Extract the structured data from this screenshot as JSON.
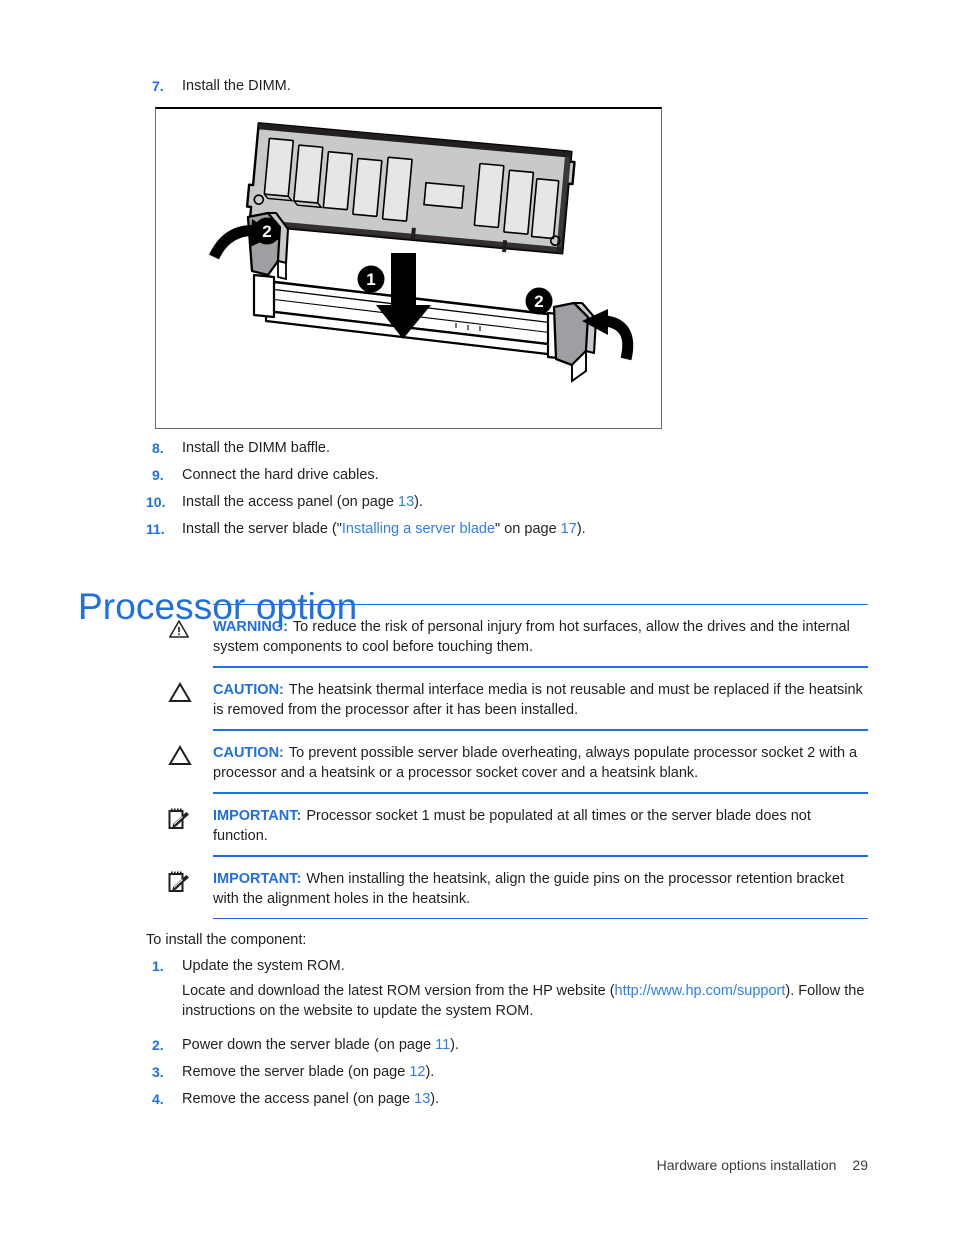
{
  "document": {
    "steps_top": [
      {
        "number": "7.",
        "text": "Install the DIMM."
      }
    ],
    "figure": {
      "caption_alt": "DIMM installation into socket",
      "callouts": [
        {
          "label": "1",
          "meaning": "press DIMM straight down into socket"
        },
        {
          "label": "2",
          "meaning": "left latch closes"
        },
        {
          "label": "2",
          "meaning": "right latch closes"
        }
      ]
    },
    "steps_after_figure": [
      {
        "number": "8.",
        "text": "Install the DIMM baffle."
      },
      {
        "number": "9.",
        "text": "Connect the hard drive cables."
      },
      {
        "number": "10.",
        "text": "Install the access panel (on page ",
        "page": "13",
        "tail": ")."
      },
      {
        "number": "11.",
        "text": "Install the server blade (\"",
        "link": "Installing a server blade",
        "mid": "\" on page ",
        "page": "17",
        "tail": ")."
      }
    ],
    "heading": "Processor option",
    "notices": [
      {
        "icon": "warning-triangle-exclamation-icon",
        "label": "WARNING:",
        "text": "To reduce the risk of personal injury from hot surfaces, allow the drives and the internal system components to cool before touching them."
      },
      {
        "icon": "caution-triangle-icon",
        "label": "CAUTION:",
        "text": "The heatsink thermal interface media is not reusable and must be replaced if the heatsink is removed from the processor after it has been installed."
      },
      {
        "icon": "caution-triangle-icon",
        "label": "CAUTION:",
        "text": "To prevent possible server blade overheating, always populate processor socket 2 with a processor and a heatsink or a processor socket cover and a heatsink blank."
      },
      {
        "icon": "important-notepad-pencil-icon",
        "label": "IMPORTANT:",
        "text": "Processor socket 1 must be populated at all times or the server blade does not function."
      },
      {
        "icon": "important-notepad-pencil-icon",
        "label": "IMPORTANT:",
        "text": "When installing the heatsink, align the guide pins on the processor retention bracket with the alignment holes in the heatsink."
      }
    ],
    "lead_in": "To install the component:",
    "steps_bottom": [
      {
        "number": "1.",
        "text": "Update the system ROM.",
        "sub_pre": "Locate and download the latest ROM version from the HP website (",
        "sub_link": "http://www.hp.com/support",
        "sub_post": "). Follow the instructions on the website to update the system ROM."
      },
      {
        "number": "2.",
        "text": "Power down the server blade (on page ",
        "page": "11",
        "tail": ")."
      },
      {
        "number": "3.",
        "text": "Remove the server blade (on page ",
        "page": "12",
        "tail": ")."
      },
      {
        "number": "4.",
        "text": "Remove the access panel (on page ",
        "page": "13",
        "tail": ")."
      }
    ],
    "footer": {
      "section": "Hardware options installation",
      "page_number": "29"
    },
    "colors": {
      "accent_blue": "#1f6fe0",
      "link_blue": "#2f7fe8",
      "text": "#231f20",
      "figure_border": "#6d6e71",
      "chip_fill": "#c8c9cb"
    }
  }
}
